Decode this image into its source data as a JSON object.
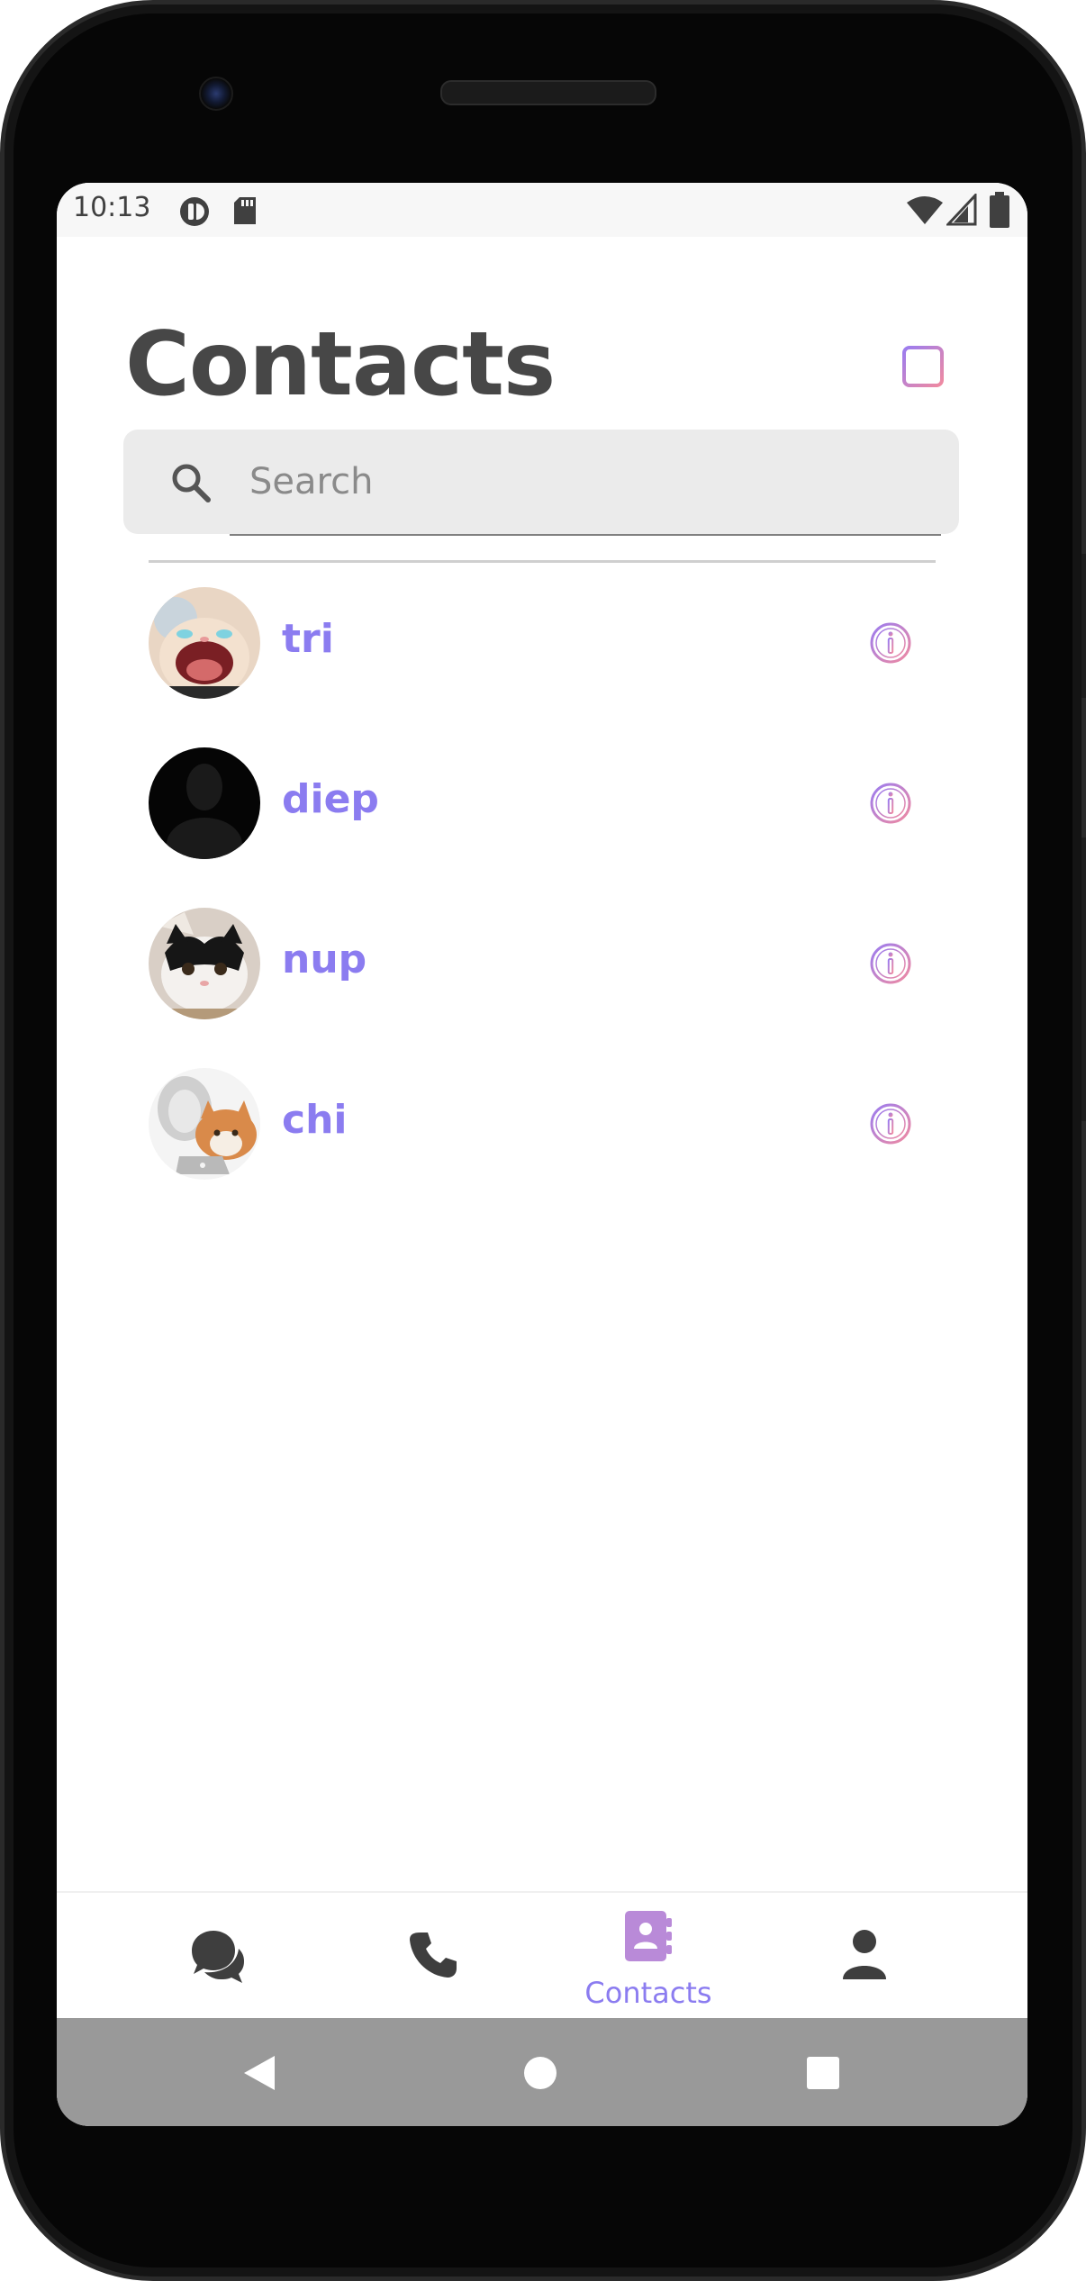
{
  "status_bar": {
    "time": "10:13",
    "left_icons": [
      "app-notification-icon",
      "sd-card-icon"
    ],
    "right_icons": [
      "wifi-icon",
      "signal-icon",
      "battery-icon"
    ]
  },
  "header": {
    "title": "Contacts",
    "add_icon": "add-square-icon"
  },
  "search": {
    "placeholder": "Search",
    "value": "",
    "icon": "search-icon"
  },
  "contacts": [
    {
      "name": "tri",
      "avatar": "crying-cat-photo"
    },
    {
      "name": "diep",
      "avatar": "black-placeholder"
    },
    {
      "name": "nup",
      "avatar": "black-white-cat-photo"
    },
    {
      "name": "chi",
      "avatar": "orange-cat-laptop-photo"
    }
  ],
  "tab_bar": {
    "tabs": [
      {
        "icon": "chat-icon",
        "label": "",
        "active": false
      },
      {
        "icon": "phone-icon",
        "label": "",
        "active": false
      },
      {
        "icon": "contacts-book-icon",
        "label": "Contacts",
        "active": true
      },
      {
        "icon": "profile-icon",
        "label": "",
        "active": false
      }
    ]
  },
  "navigation_bar": {
    "buttons": [
      "back-triangle-icon",
      "home-circle-icon",
      "recents-square-icon"
    ]
  },
  "colors": {
    "accent": "#8b7cf0",
    "active_tab_icon": "#b98ad8",
    "title_text": "#474747",
    "search_bg": "#ebebeb",
    "nav_bar_bg": "#999999",
    "gradient_start": "#9b7cf0",
    "gradient_end": "#f08aa0"
  }
}
